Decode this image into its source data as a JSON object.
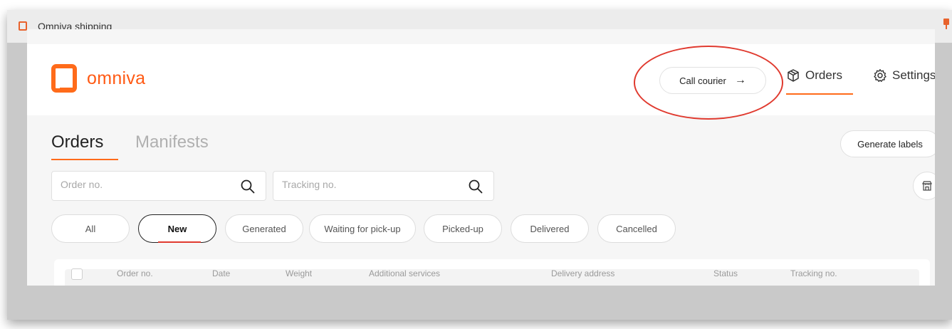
{
  "window": {
    "title": "Omniva shipping"
  },
  "header": {
    "logo_text": "omniva",
    "call_courier_label": "Call courier",
    "call_courier_arrow": "→",
    "nav": [
      {
        "label": "Orders",
        "icon": "box-icon",
        "active": true
      },
      {
        "label": "Settings",
        "icon": "gear-icon",
        "active": false
      }
    ]
  },
  "tabs": [
    {
      "label": "Orders",
      "active": true
    },
    {
      "label": "Manifests",
      "active": false
    }
  ],
  "actions": {
    "generate_labels": "Generate labels"
  },
  "search": {
    "order_placeholder": "Order no.",
    "tracking_placeholder": "Tracking no."
  },
  "filters": [
    {
      "label": "All",
      "active": false
    },
    {
      "label": "New",
      "active": true
    },
    {
      "label": "Generated",
      "active": false
    },
    {
      "label": "Waiting for pick-up",
      "active": false
    },
    {
      "label": "Picked-up",
      "active": false
    },
    {
      "label": "Delivered",
      "active": false
    },
    {
      "label": "Cancelled",
      "active": false
    }
  ],
  "table": {
    "columns": [
      "Order no.",
      "Date",
      "Weight",
      "Additional services",
      "Delivery address",
      "Status",
      "Tracking no."
    ]
  },
  "colors": {
    "brand_orange": "#ff6b1a",
    "annotation_red": "#e03a2f"
  }
}
